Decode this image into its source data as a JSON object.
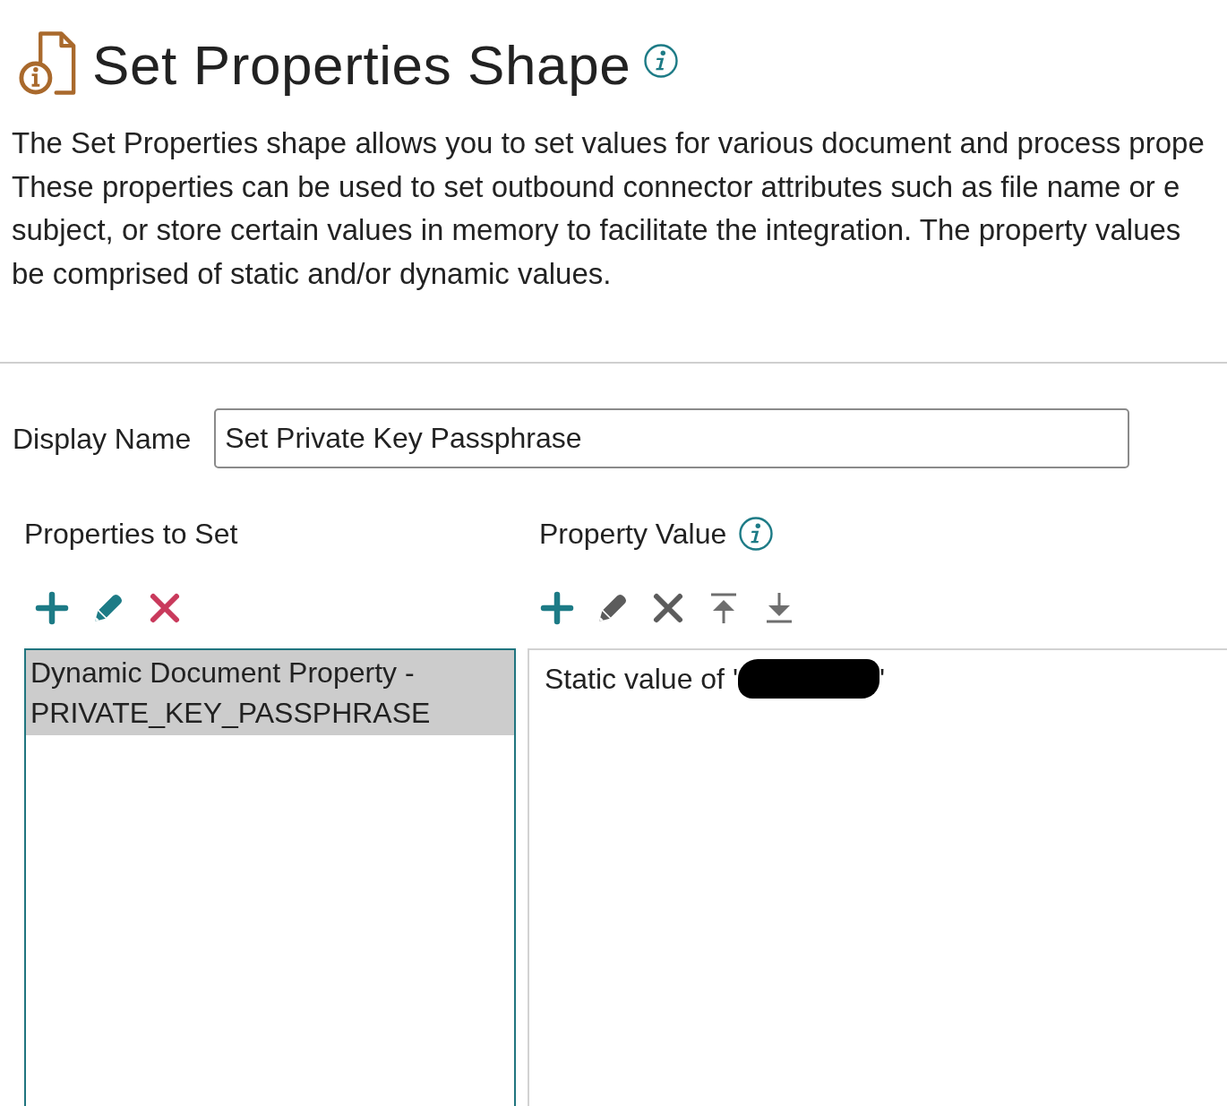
{
  "header": {
    "title": "Set Properties Shape",
    "description": "The Set Properties shape allows you to set values for various document and process prope\nThese properties can be used to set outbound connector attributes such as file name or e\nsubject, or store certain values in memory to facilitate the integration. The property values\nbe comprised of static and/or dynamic values."
  },
  "display_name": {
    "label": "Display Name",
    "value": "Set Private Key Passphrase"
  },
  "properties_panel": {
    "title": "Properties to Set",
    "toolbar": [
      {
        "kind": "add",
        "disabled": false
      },
      {
        "kind": "edit",
        "disabled": false
      },
      {
        "kind": "delete",
        "disabled": false
      }
    ],
    "items": [
      {
        "text": "Dynamic Document Property - PRIVATE_KEY_PASSPHRASE",
        "selected": true
      }
    ]
  },
  "value_panel": {
    "title": "Property Value",
    "toolbar": [
      {
        "kind": "add",
        "disabled": false
      },
      {
        "kind": "edit",
        "disabled": true
      },
      {
        "kind": "delete",
        "disabled": true
      },
      {
        "kind": "move_top",
        "disabled": true
      },
      {
        "kind": "move_bottom",
        "disabled": true
      }
    ],
    "items": [
      {
        "text_before": "Static value of '",
        "redacted": true,
        "text_after": "'",
        "selected": false
      }
    ]
  }
}
